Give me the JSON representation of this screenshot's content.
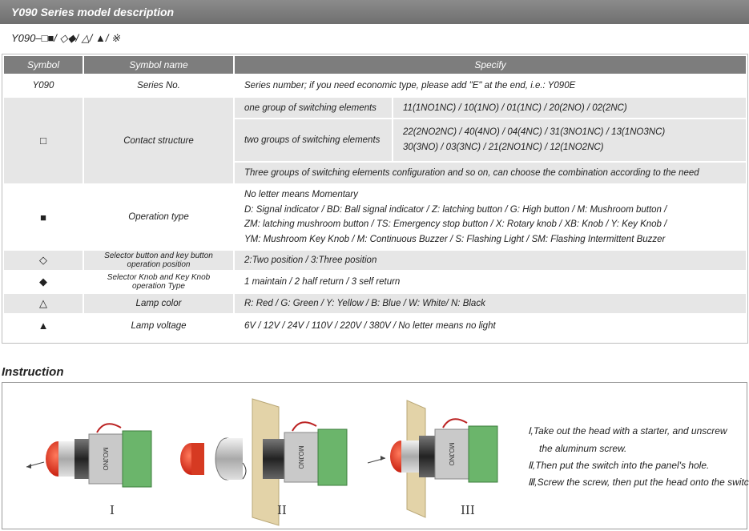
{
  "title": "Y090  Series model description",
  "formula": "Y090–□■/ ◇◆/ △/ ▲/ ※",
  "table": {
    "headers": [
      "Symbol",
      "Symbol name",
      "Specify"
    ],
    "row_series": {
      "symbol": "Y090",
      "name": "Series No.",
      "spec": "Series number; if you need economic type, please add \"E\" at the end, i.e.: Y090E"
    },
    "row_contact": {
      "symbol": "□",
      "name": "Contact structure",
      "one_label": "one group of switching elements",
      "one_value": "11(1NO1NC) / 10(1NO) / 01(1NC) / 20(2NO) / 02(2NC)",
      "two_label": "two groups of switching elements",
      "two_value_1": "22(2NO2NC) / 40(4NO) / 04(4NC) / 31(3NO1NC) / 13(1NO3NC)",
      "two_value_2": "30(3NO) / 03(3NC) / 21(2NO1NC) / 12(1NO2NC)",
      "three_note": "Three groups of switching elements configuration and so on, can choose the combination according to the need"
    },
    "row_operation": {
      "symbol": "■",
      "name": "Operation type",
      "lines": [
        "No letter means Momentary",
        "D: Signal indicator / BD: Ball signal indicator / Z: latching button / G: High button / M: Mushroom button /",
        "ZM: latching mushroom button / TS: Emergency stop button / X: Rotary knob / XB: Knob / Y: Key Knob /",
        "YM: Mushroom Key Knob / M: Continuous Buzzer / S: Flashing Light / SM: Flashing Intermittent Buzzer"
      ]
    },
    "row_selector_pos": {
      "symbol": "◇",
      "name_1": "Selector button and key button",
      "name_2": "operation position",
      "spec": "2:Two position / 3:Three position"
    },
    "row_selector_type": {
      "symbol": "◆",
      "name_1": "Selector Knob and Key Knob",
      "name_2": "operation Type",
      "spec": "1 maintain / 2 half return / 3 self return"
    },
    "row_lamp_color": {
      "symbol": "△",
      "name": "Lamp color",
      "spec": "R: Red / G: Green / Y: Yellow / B: Blue / W: White/ N: Black"
    },
    "row_lamp_voltage": {
      "symbol": "▲",
      "name": "Lamp voltage",
      "spec": "6V / 12V / 24V / 110V / 220V / 380V / No letter means no light"
    }
  },
  "instruction": {
    "title": "Instruction",
    "roman": [
      "I",
      "II",
      "III"
    ],
    "steps": [
      {
        "num": "Ⅰ",
        "text_1": "Take out the head with a starter, and unscrew",
        "text_2": "the aluminum screw."
      },
      {
        "num": "Ⅱ",
        "text_1": "Then put the switch into the panel's hole."
      },
      {
        "num": "Ⅲ",
        "text_1": "Screw the screw, then put the head onto the switch."
      }
    ],
    "brand_label": "MOJNO",
    "colors": {
      "lens_red": "#e23a22",
      "panel": "#e3d3a8",
      "pcb_green": "#5fa860"
    }
  }
}
